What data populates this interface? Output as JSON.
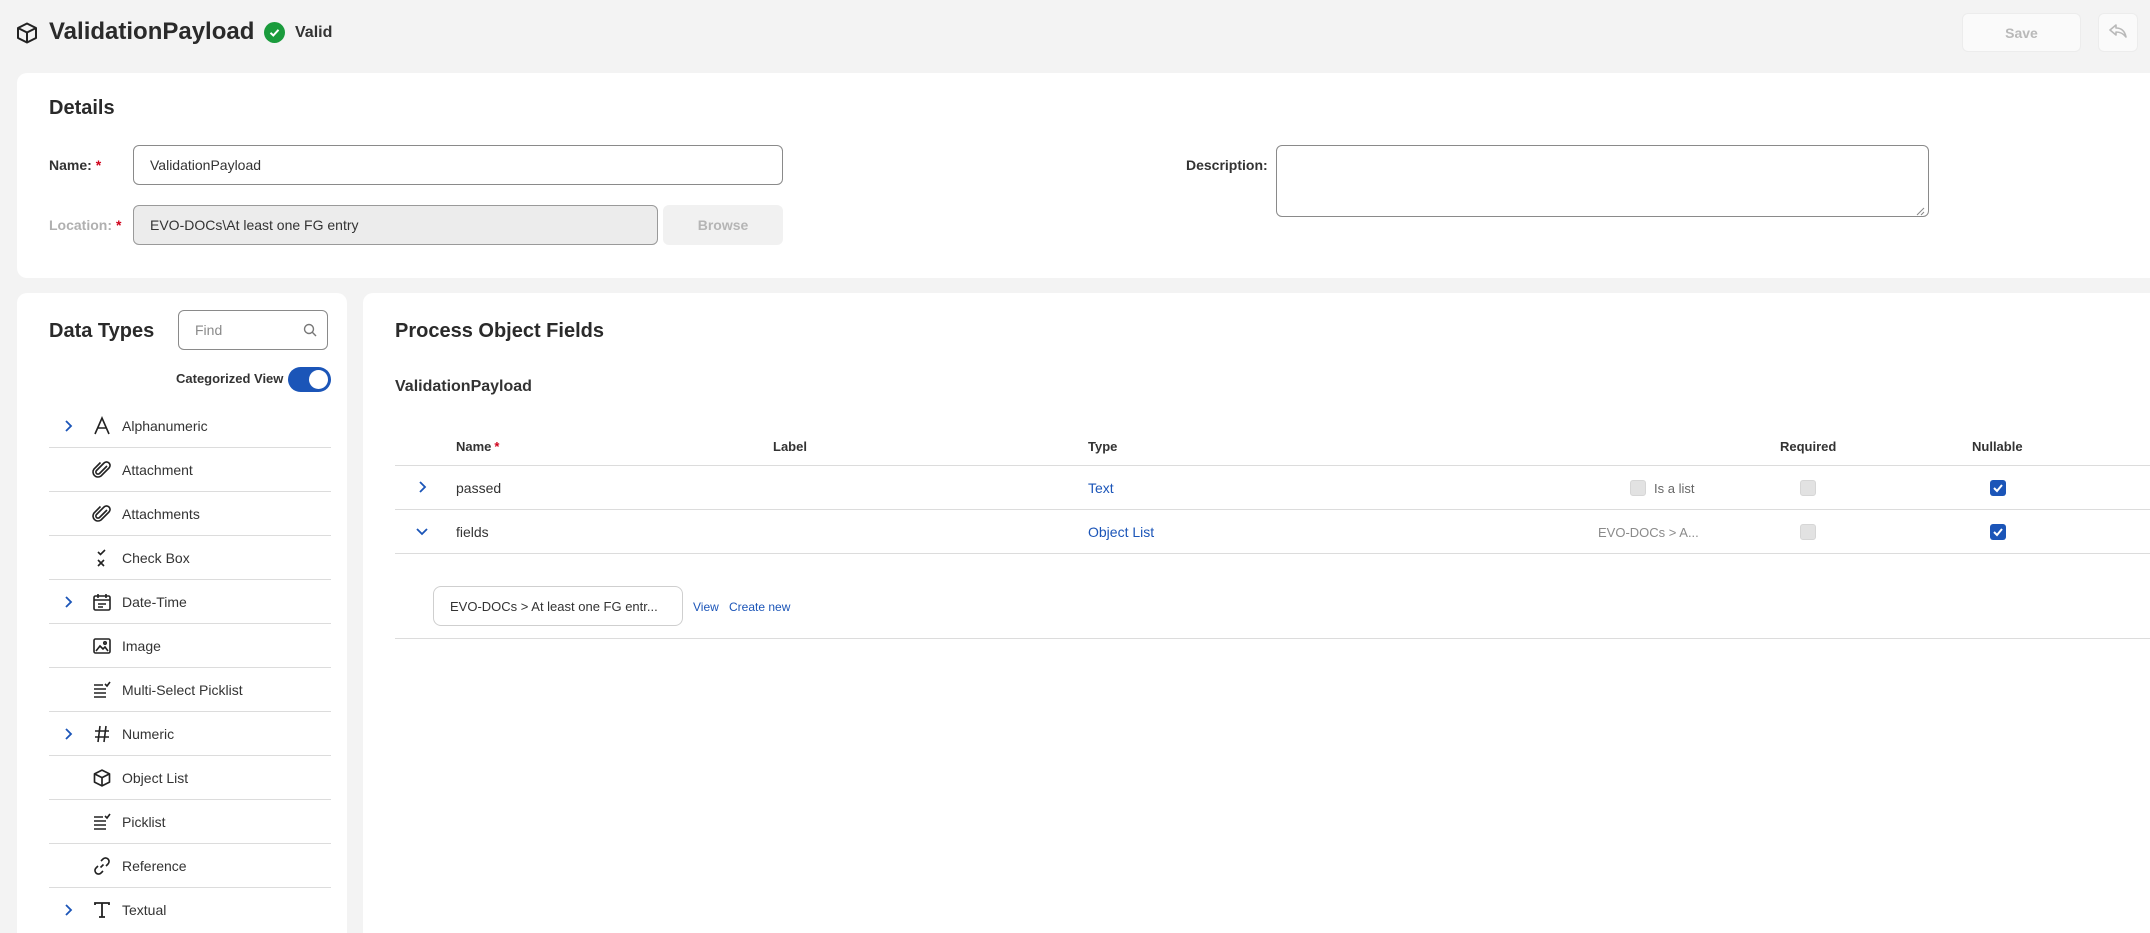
{
  "header": {
    "title": "ValidationPayload",
    "status": "Valid",
    "save_label": "Save"
  },
  "details": {
    "heading": "Details",
    "name_label": "Name:",
    "name_value": "ValidationPayload",
    "location_label": "Location:",
    "location_value": "EVO-DOCs\\At least one FG entry",
    "browse_label": "Browse",
    "description_label": "Description:",
    "description_value": "",
    "required_mark": "*"
  },
  "data_types": {
    "heading": "Data Types",
    "find_placeholder": "Find",
    "categorized_label": "Categorized View",
    "categorized_on": true,
    "items": [
      {
        "label": "Alphanumeric",
        "icon": "letter-a-icon",
        "expandable": true
      },
      {
        "label": "Attachment",
        "icon": "paperclip-icon",
        "expandable": false
      },
      {
        "label": "Attachments",
        "icon": "paperclip-icon",
        "expandable": false
      },
      {
        "label": "Check Box",
        "icon": "checkbox-icon",
        "expandable": false
      },
      {
        "label": "Date-Time",
        "icon": "calendar-icon",
        "expandable": true
      },
      {
        "label": "Image",
        "icon": "image-icon",
        "expandable": false
      },
      {
        "label": "Multi-Select Picklist",
        "icon": "multi-picklist-icon",
        "expandable": false
      },
      {
        "label": "Numeric",
        "icon": "hash-icon",
        "expandable": true
      },
      {
        "label": "Object List",
        "icon": "cube-icon",
        "expandable": false
      },
      {
        "label": "Picklist",
        "icon": "picklist-icon",
        "expandable": false
      },
      {
        "label": "Reference",
        "icon": "link-icon",
        "expandable": false
      },
      {
        "label": "Textual",
        "icon": "letter-t-icon",
        "expandable": true
      }
    ]
  },
  "fields": {
    "heading": "Process Object Fields",
    "object_name": "ValidationPayload",
    "columns": {
      "name": "Name",
      "label": "Label",
      "type": "Type",
      "required": "Required",
      "nullable": "Nullable"
    },
    "rows": [
      {
        "name": "passed",
        "label": "",
        "type": "Text",
        "extra": "Is a list",
        "is_list": false,
        "required": false,
        "nullable": true,
        "expanded": false
      },
      {
        "name": "fields",
        "label": "",
        "type": "Object List",
        "extra": "EVO-DOCs > A...",
        "required": false,
        "nullable": true,
        "expanded": true
      }
    ],
    "expanded_ref": "EVO-DOCs > At least one FG entr...",
    "view_label": "View",
    "create_label": "Create new"
  },
  "colors": {
    "accent": "#1b55b8",
    "valid": "#1a9b3c",
    "required": "#d0021b"
  }
}
